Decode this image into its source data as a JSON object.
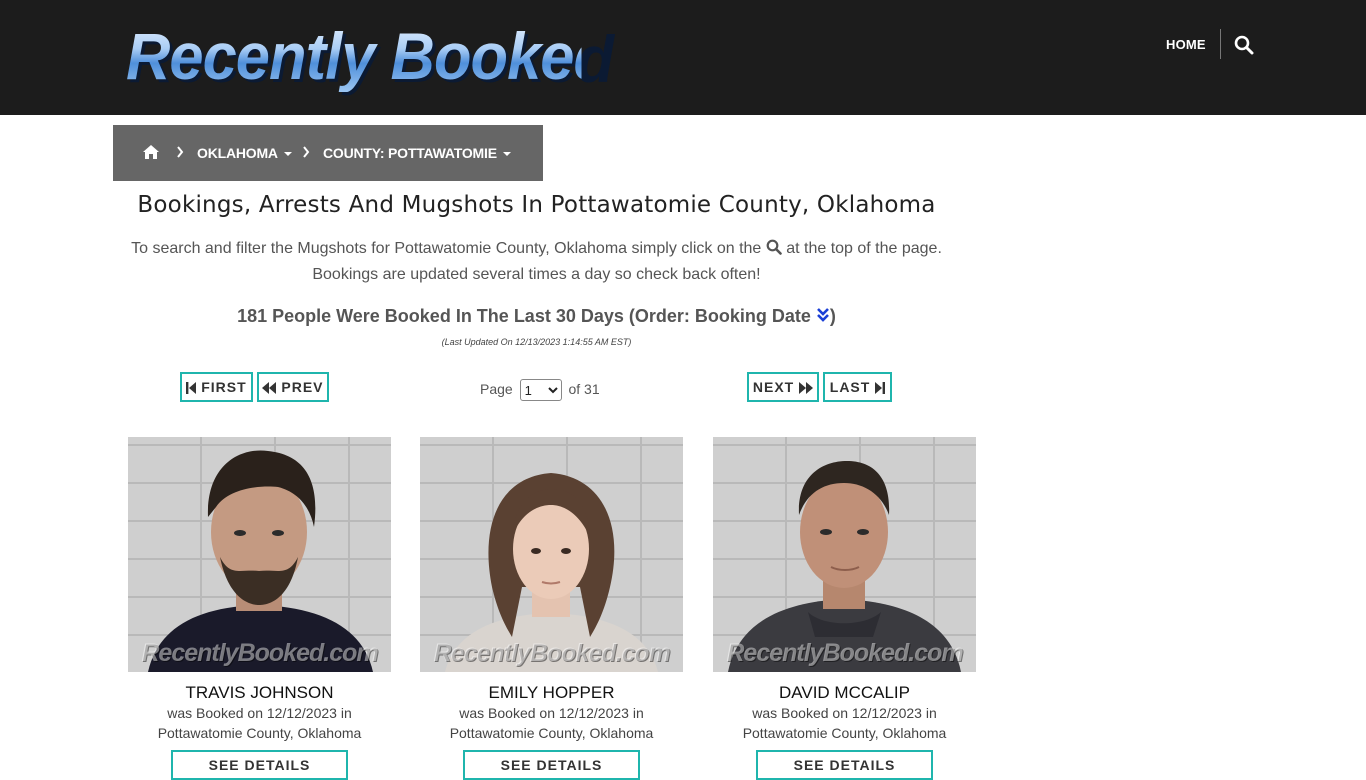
{
  "header": {
    "logo_text": "Recently Booked",
    "nav_home": "HOME"
  },
  "breadcrumb": {
    "state": "OKLAHOMA",
    "county": "COUNTY: POTTAWATOMIE"
  },
  "title": "Bookings, Arrests And Mugshots In Pottawatomie County, Oklahoma",
  "intro": {
    "before_icon": "To search and filter the Mugshots for Pottawatomie County, Oklahoma simply click on the",
    "after_icon": "at the top of the page. Bookings are updated several times a day so check back often!"
  },
  "count_text": "181 People Were Booked In The Last 30 Days (Order: Booking Date",
  "count_close": ")",
  "last_updated": "(Last Updated On 12/13/2023 1:14:55 AM EST)",
  "pager": {
    "first": "FIRST",
    "prev": "PREV",
    "next": "NEXT",
    "last": "LAST",
    "page_label": "Page",
    "page_value": "1",
    "of_label": "of 31"
  },
  "watermark": "RecentlyBooked.com",
  "people": [
    {
      "name": "TRAVIS JOHNSON",
      "line1": "was Booked on 12/12/2023 in",
      "line2": "Pottawatomie County, Oklahoma",
      "button": "SEE DETAILS"
    },
    {
      "name": "EMILY HOPPER",
      "line1": "was Booked on 12/12/2023 in",
      "line2": "Pottawatomie County, Oklahoma",
      "button": "SEE DETAILS"
    },
    {
      "name": "DAVID MCCALIP",
      "line1": "was Booked on 12/12/2023 in",
      "line2": "Pottawatomie County, Oklahoma",
      "button": "SEE DETAILS"
    }
  ],
  "colors": {
    "header_bg": "#1c1c1c",
    "breadcrumb_bg": "#666666",
    "accent_teal": "#1fb5ad",
    "sort_icon": "#1a3fd6"
  },
  "icons": [
    "home-icon",
    "search-icon",
    "chevron-right-icon",
    "step-backward-icon",
    "backward-icon",
    "forward-icon",
    "step-forward-icon",
    "double-chevron-down-icon"
  ]
}
